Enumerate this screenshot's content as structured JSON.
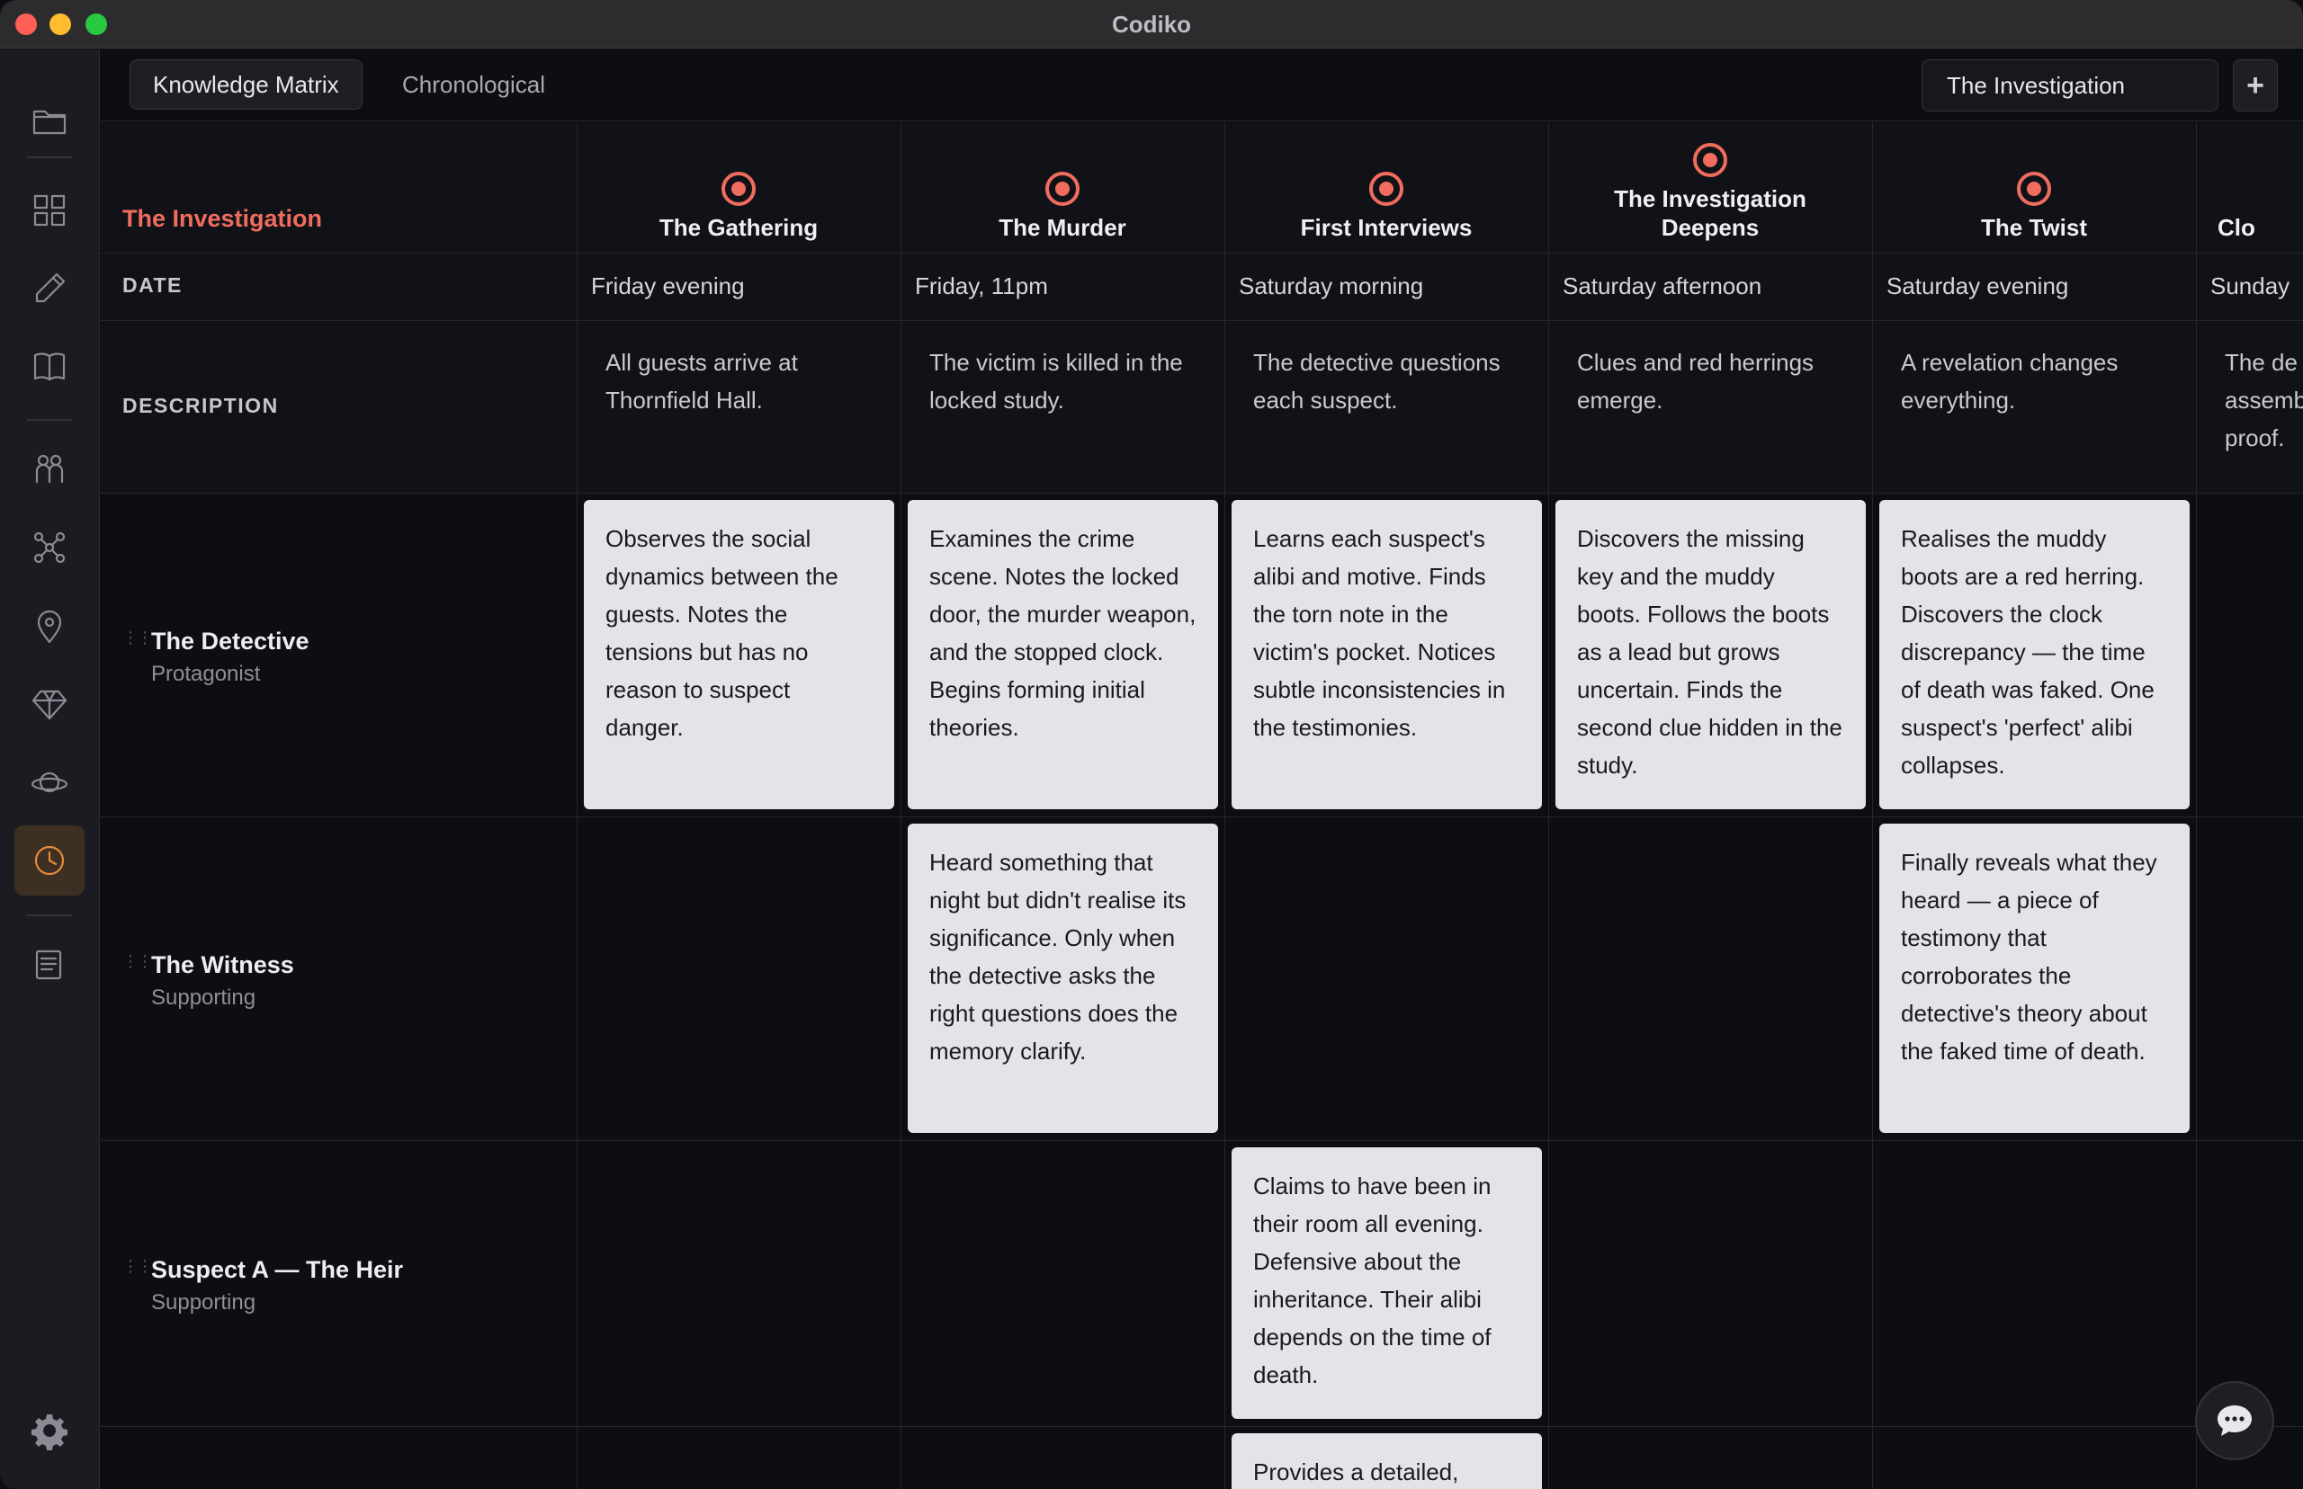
{
  "window": {
    "title": "Codiko"
  },
  "sidebar": {
    "items": [
      {
        "icon": "folder-icon"
      },
      {
        "icon": "grid-icon"
      },
      {
        "icon": "pencil-icon"
      },
      {
        "icon": "book-icon"
      },
      {
        "icon": "characters-icon"
      },
      {
        "icon": "graph-icon"
      },
      {
        "icon": "location-pin-icon"
      },
      {
        "icon": "gem-icon"
      },
      {
        "icon": "planet-icon"
      },
      {
        "icon": "clock-icon",
        "active": true
      },
      {
        "icon": "notes-icon"
      }
    ],
    "settings_icon": "gear-icon"
  },
  "tabs": [
    {
      "label": "Knowledge Matrix",
      "active": true
    },
    {
      "label": "Chronological",
      "active": false
    }
  ],
  "project_select": {
    "value": "The Investigation"
  },
  "add_button": {
    "label": "+"
  },
  "matrix": {
    "corner_title": "The Investigation",
    "row_labels": {
      "date": "DATE",
      "description": "DESCRIPTION"
    },
    "columns": [
      {
        "title": "The Gathering",
        "date": "Friday evening",
        "description": "All guests arrive at Thornfield Hall."
      },
      {
        "title": "The Murder",
        "date": "Friday, 11pm",
        "description": "The victim is killed in the locked study."
      },
      {
        "title": "First Interviews",
        "date": "Saturday morning",
        "description": "The detective questions each suspect."
      },
      {
        "title": "The Investigation Deepens",
        "date": "Saturday afternoon",
        "description": "Clues and red herrings emerge."
      },
      {
        "title": "The Twist",
        "date": "Saturday evening",
        "description": "A revelation changes everything."
      },
      {
        "title": "Clo",
        "date": "Sunday",
        "description": "The de assemb proof."
      }
    ],
    "characters": [
      {
        "name": "The Detective",
        "role": "Protagonist",
        "cards": [
          "Observes the social dynamics between the guests. Notes the tensions but has no reason to suspect danger.",
          "Examines the crime scene. Notes the locked door, the murder weapon, and the stopped clock. Begins forming initial theories.",
          "Learns each suspect's alibi and motive. Finds the torn note in the victim's pocket. Notices subtle inconsistencies in the testimonies.",
          "Discovers the missing key and the muddy boots. Follows the boots as a lead but grows uncertain. Finds the second clue hidden in the study.",
          "Realises the muddy boots are a red herring. Discovers the clock discrepancy — the time of death was faked. One suspect's 'perfect' alibi collapses."
        ]
      },
      {
        "name": "The Witness",
        "role": "Supporting",
        "cards": [
          "Heard something that night but didn't realise its significance. Only when the detective asks the right questions does the memory clarify.",
          "Finally reveals what they heard — a piece of testimony that corroborates the detective's theory about the faked time of death."
        ]
      },
      {
        "name": "Suspect A — The Heir",
        "role": "Supporting",
        "cards": [
          "Claims to have been in their room all evening. Defensive about the inheritance. Their alibi depends on the time of death."
        ]
      },
      {
        "cards": [
          "Provides a detailed,"
        ]
      }
    ]
  },
  "chat_button": {
    "icon": "chat-bubble-icon"
  }
}
